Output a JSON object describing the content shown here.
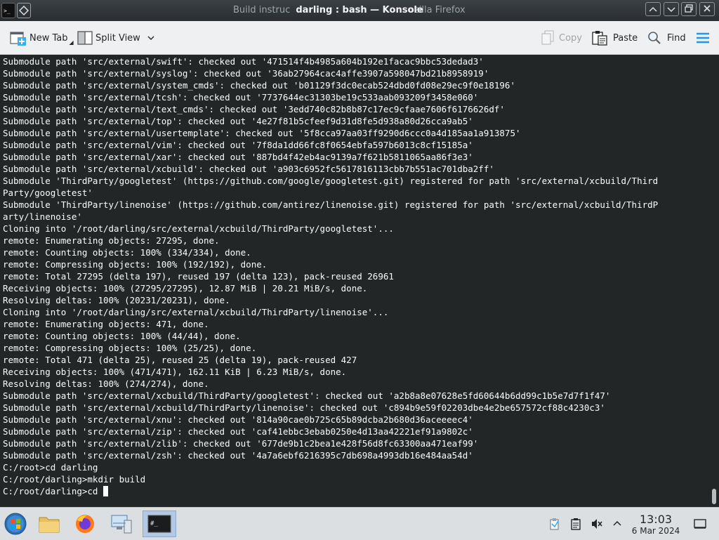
{
  "window": {
    "title": "darling : bash — Konsole",
    "title_ghost_left": "Build instruc",
    "title_ghost_right": "ozilla Firefox"
  },
  "toolbar": {
    "new_tab": "New Tab",
    "split_view": "Split View",
    "copy": "Copy",
    "paste": "Paste",
    "find": "Find"
  },
  "terminal": {
    "lines": [
      "Submodule path 'src/external/swift': checked out '471514f4b4985a604b192e1facac9bbc53dedad3'",
      "Submodule path 'src/external/syslog': checked out '36ab27964cac4affe3907a598047bd21b8958919'",
      "Submodule path 'src/external/system_cmds': checked out 'b01129f3dc0ecab524dbd0fd08e29ec9f0e18196'",
      "Submodule path 'src/external/tcsh': checked out '7737644ec31303be19c533aab093209f3458e060'",
      "Submodule path 'src/external/text_cmds': checked out '3edd740c82b8b87c17ec9cfaae7606f6176626df'",
      "Submodule path 'src/external/top': checked out '4e27f81b5cfeef9d31d8fe5d938a80d26cca9ab5'",
      "Submodule path 'src/external/usertemplate': checked out '5f8cca97aa03ff9290d6ccc0a4d185aa1a913875'",
      "Submodule path 'src/external/vim': checked out '7f8da1dd66fc8f0654ebfa597b6013c8cf15185a'",
      "Submodule path 'src/external/xar': checked out '887bd4f42eb4ac9139a7f621b5811065aa86f3e3'",
      "Submodule path 'src/external/xcbuild': checked out 'a903c6952fc5617816113cbb7b551ac701dba2ff'",
      "Submodule 'ThirdParty/googletest' (https://github.com/google/googletest.git) registered for path 'src/external/xcbuild/Third",
      "Party/googletest'",
      "Submodule 'ThirdParty/linenoise' (https://github.com/antirez/linenoise.git) registered for path 'src/external/xcbuild/ThirdP",
      "arty/linenoise'",
      "Cloning into '/root/darling/src/external/xcbuild/ThirdParty/googletest'...",
      "remote: Enumerating objects: 27295, done.",
      "remote: Counting objects: 100% (334/334), done.",
      "remote: Compressing objects: 100% (192/192), done.",
      "remote: Total 27295 (delta 197), reused 197 (delta 123), pack-reused 26961",
      "Receiving objects: 100% (27295/27295), 12.87 MiB | 20.21 MiB/s, done.",
      "Resolving deltas: 100% (20231/20231), done.",
      "Cloning into '/root/darling/src/external/xcbuild/ThirdParty/linenoise'...",
      "remote: Enumerating objects: 471, done.",
      "remote: Counting objects: 100% (44/44), done.",
      "remote: Compressing objects: 100% (25/25), done.",
      "remote: Total 471 (delta 25), reused 25 (delta 19), pack-reused 427",
      "Receiving objects: 100% (471/471), 162.11 KiB | 6.23 MiB/s, done.",
      "Resolving deltas: 100% (274/274), done.",
      "Submodule path 'src/external/xcbuild/ThirdParty/googletest': checked out 'a2b8a8e07628e5fd60644b6dd99c1b5e7d7f1f47'",
      "Submodule path 'src/external/xcbuild/ThirdParty/linenoise': checked out 'c894b9e59f02203dbe4e2be657572cf88c4230c3'",
      "Submodule path 'src/external/xnu': checked out '814a90cae0b725c65b89dcba2b680d36aceeeec4'",
      "Submodule path 'src/external/zip': checked out 'caf41ebbc3ebab0250e4d13aa42221ef91a9802c'",
      "Submodule path 'src/external/zlib': checked out '677de9b1c2bea1e428f56d8fc63300aa471eaf99'",
      "Submodule path 'src/external/zsh': checked out '4a7a6ebf6216395c7db698a4993db16e484aa54d'",
      "C:/root>cd darling",
      "C:/root/darling>mkdir build"
    ],
    "prompt": "C:/root/darling>cd "
  },
  "taskbar": {
    "time": "13:03",
    "date": "6 Mar 2024",
    "apps": [
      "start-menu",
      "file-manager",
      "firefox",
      "system-settings",
      "konsole"
    ]
  },
  "colors": {
    "terminal_bg": "#232627",
    "terminal_fg": "#fcfcfc",
    "accent": "#1d99f3"
  }
}
